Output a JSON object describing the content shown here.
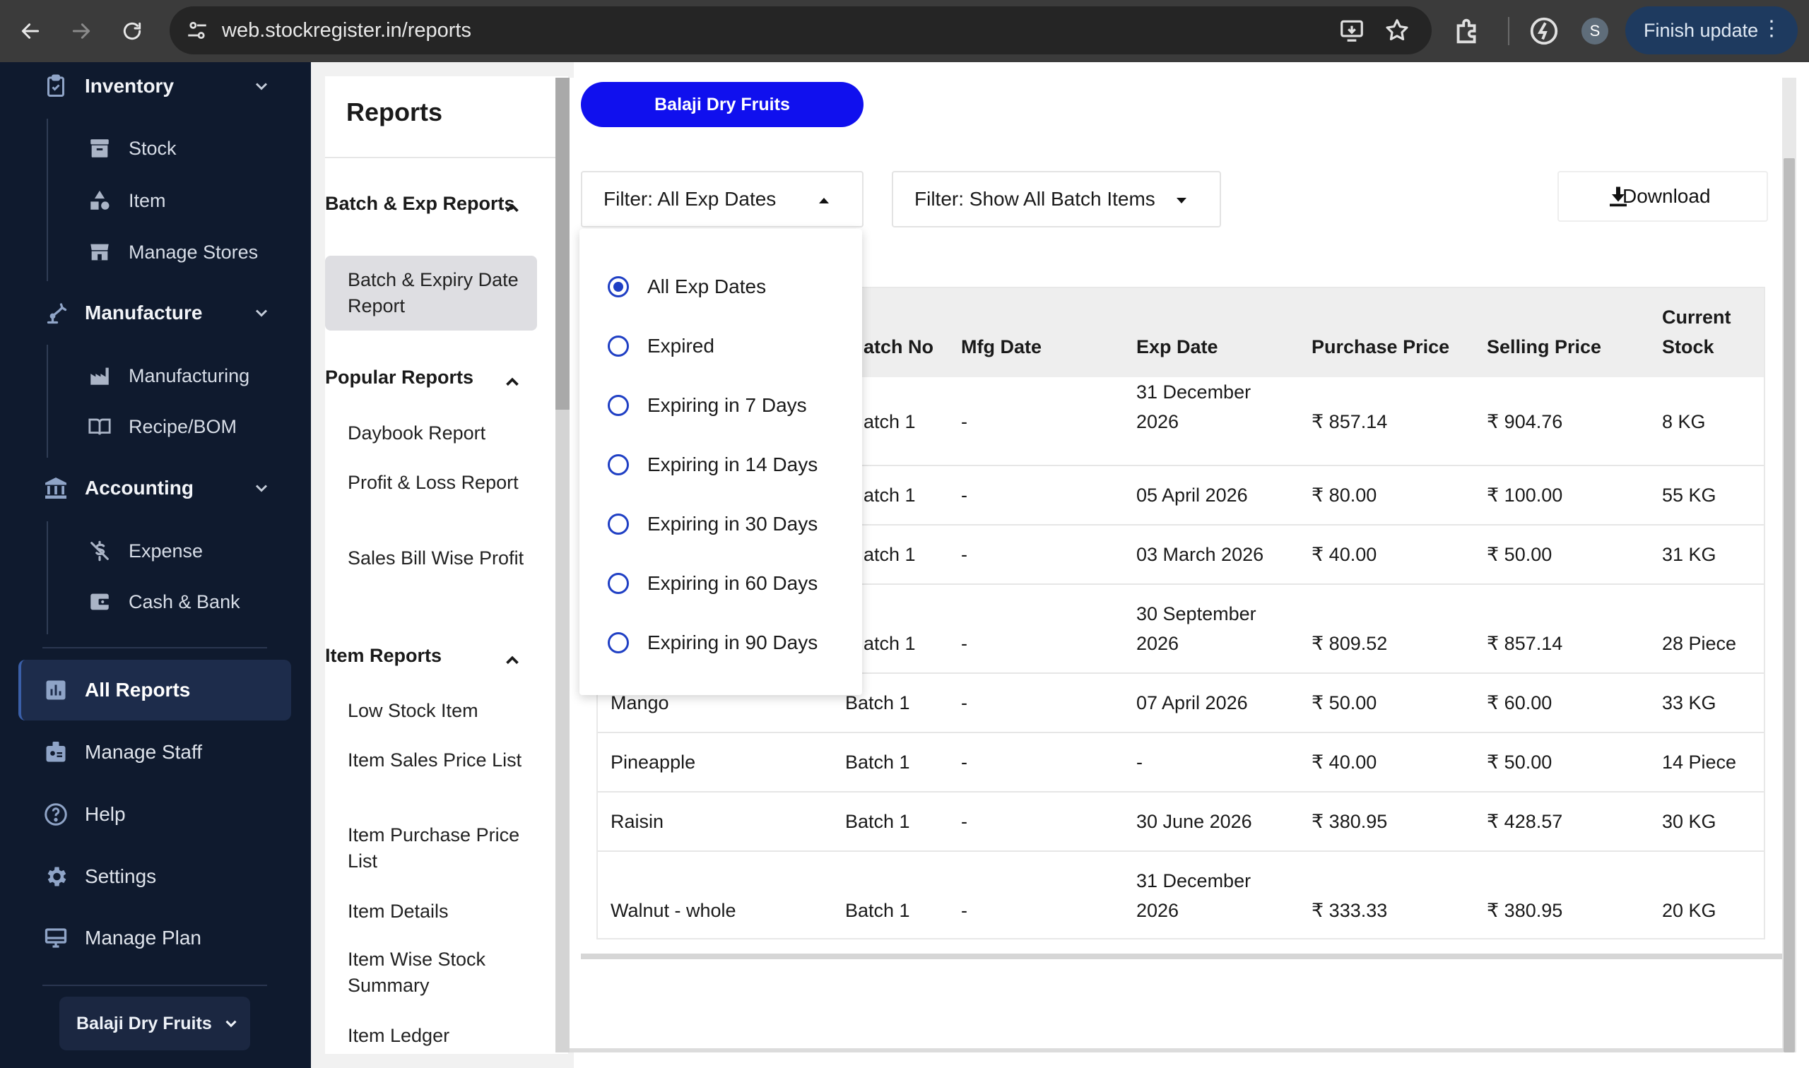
{
  "browser": {
    "url": "web.stockregister.in/reports",
    "profile_initial": "S",
    "finish_update": "Finish update"
  },
  "sidebar": {
    "groups": [
      {
        "label": "Inventory",
        "icon": "clipboard-icon",
        "items": [
          {
            "label": "Stock",
            "icon": "archive-box-icon"
          },
          {
            "label": "Item",
            "icon": "shapes-icon"
          },
          {
            "label": "Manage Stores",
            "icon": "store-icon"
          }
        ]
      },
      {
        "label": "Manufacture",
        "icon": "robot-arm-icon",
        "items": [
          {
            "label": "Manufacturing",
            "icon": "factory-icon"
          },
          {
            "label": "Recipe/BOM",
            "icon": "book-open-icon"
          }
        ]
      },
      {
        "label": "Accounting",
        "icon": "bank-icon",
        "items": [
          {
            "label": "Expense",
            "icon": "money-off-icon"
          },
          {
            "label": "Cash & Bank",
            "icon": "wallet-icon"
          }
        ]
      }
    ],
    "main_items": [
      {
        "label": "All Reports",
        "icon": "bar-chart-icon",
        "active": true
      },
      {
        "label": "Manage Staff",
        "icon": "id-badge-icon"
      },
      {
        "label": "Help",
        "icon": "help-circle-icon"
      },
      {
        "label": "Settings",
        "icon": "gear-icon"
      },
      {
        "label": "Manage Plan",
        "icon": "monitor-icon"
      }
    ],
    "store_selector": "Balaji Dry Fruits"
  },
  "reports": {
    "title": "Reports",
    "sections": [
      {
        "title": "Batch & Exp Reports",
        "items": [
          "Batch & Expiry Date Report"
        ],
        "active_item": "Batch & Expiry Date Report"
      },
      {
        "title": "Popular Reports",
        "items": [
          "Daybook Report",
          "Profit & Loss Report",
          "Sales Bill Wise Profit"
        ]
      },
      {
        "title": "Item Reports",
        "items": [
          "Low Stock Item",
          "Item Sales Price List",
          "Item Purchase Price List",
          "Item Details",
          "Item Wise Stock Summary",
          "Item Ledger"
        ]
      }
    ]
  },
  "main": {
    "store_pill": "Balaji Dry Fruits",
    "filter_exp": "Filter: All Exp Dates",
    "filter_batch": "Filter: Show All Batch Items",
    "download": "Download",
    "exp_options": [
      {
        "label": "All Exp Dates",
        "selected": true
      },
      {
        "label": "Expired",
        "selected": false
      },
      {
        "label": "Expiring in 7 Days",
        "selected": false
      },
      {
        "label": "Expiring in 14 Days",
        "selected": false
      },
      {
        "label": "Expiring in 30 Days",
        "selected": false
      },
      {
        "label": "Expiring in 60 Days",
        "selected": false
      },
      {
        "label": "Expiring in 90 Days",
        "selected": false
      }
    ],
    "columns": [
      "atch No",
      "Mfg Date",
      "Exp Date",
      "Purchase Price",
      "Selling Price",
      "Current Stock"
    ],
    "rows": [
      {
        "item": "",
        "batch": "atch 1",
        "mfg": "-",
        "exp": "31 December 2026",
        "purchase": "₹ 857.14",
        "selling": "₹ 904.76",
        "stock": "8 KG"
      },
      {
        "item": "",
        "batch": "atch 1",
        "mfg": "-",
        "exp": "05 April 2026",
        "purchase": "₹ 80.00",
        "selling": "₹ 100.00",
        "stock": "55 KG"
      },
      {
        "item": "",
        "batch": "atch 1",
        "mfg": "-",
        "exp": "03 March 2026",
        "purchase": "₹ 40.00",
        "selling": "₹ 50.00",
        "stock": "31 KG"
      },
      {
        "item": "",
        "batch": "atch 1",
        "mfg": "-",
        "exp": "30 September 2026",
        "purchase": "₹ 809.52",
        "selling": "₹ 857.14",
        "stock": "28 Piece"
      },
      {
        "item": "Mango",
        "batch": "Batch 1",
        "mfg": "-",
        "exp": "07 April 2026",
        "purchase": "₹ 50.00",
        "selling": "₹ 60.00",
        "stock": "33 KG"
      },
      {
        "item": "Pineapple",
        "batch": "Batch 1",
        "mfg": "-",
        "exp": "-",
        "purchase": "₹ 40.00",
        "selling": "₹ 50.00",
        "stock": "14 Piece"
      },
      {
        "item": "Raisin",
        "batch": "Batch 1",
        "mfg": "-",
        "exp": "30 June 2026",
        "purchase": "₹ 380.95",
        "selling": "₹ 428.57",
        "stock": "30 KG"
      },
      {
        "item": "Walnut - whole",
        "batch": "Batch 1",
        "mfg": "-",
        "exp": "31 December 2026",
        "purchase": "₹ 333.33",
        "selling": "₹ 380.95",
        "stock": "20 KG"
      }
    ]
  },
  "colors": {
    "sidebar_bg": "#0f1a2e",
    "accent_blue": "#1010ee",
    "radio_blue": "#1f3fc4",
    "chrome_bg": "#3b3b3b"
  }
}
